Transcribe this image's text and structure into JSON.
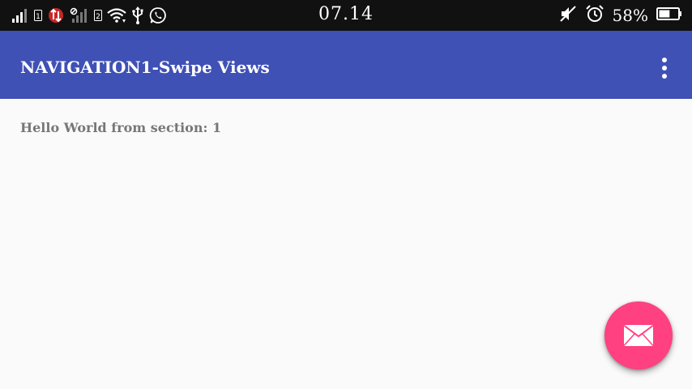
{
  "status_bar": {
    "time": "07.14",
    "battery_percent": "58%",
    "sim1_label": "1",
    "sim2_label": "2",
    "left_icons": [
      "signal-icon",
      "sim-1-badge",
      "data-transfer-icon",
      "signal-icon",
      "sim-2-badge",
      "wifi-icon",
      "usb-icon",
      "whatsapp-icon"
    ],
    "right_icons": [
      "mute-icon",
      "alarm-icon",
      "battery-icon"
    ],
    "battery_level": 0.58
  },
  "app_bar": {
    "title": "NAVIGATION1-Swipe Views",
    "menu_icon": "more-vert-icon",
    "color": "#3f51b5"
  },
  "content": {
    "section_text": "Hello World from section: 1"
  },
  "fab": {
    "icon": "mail-icon",
    "color": "#ff4081"
  }
}
